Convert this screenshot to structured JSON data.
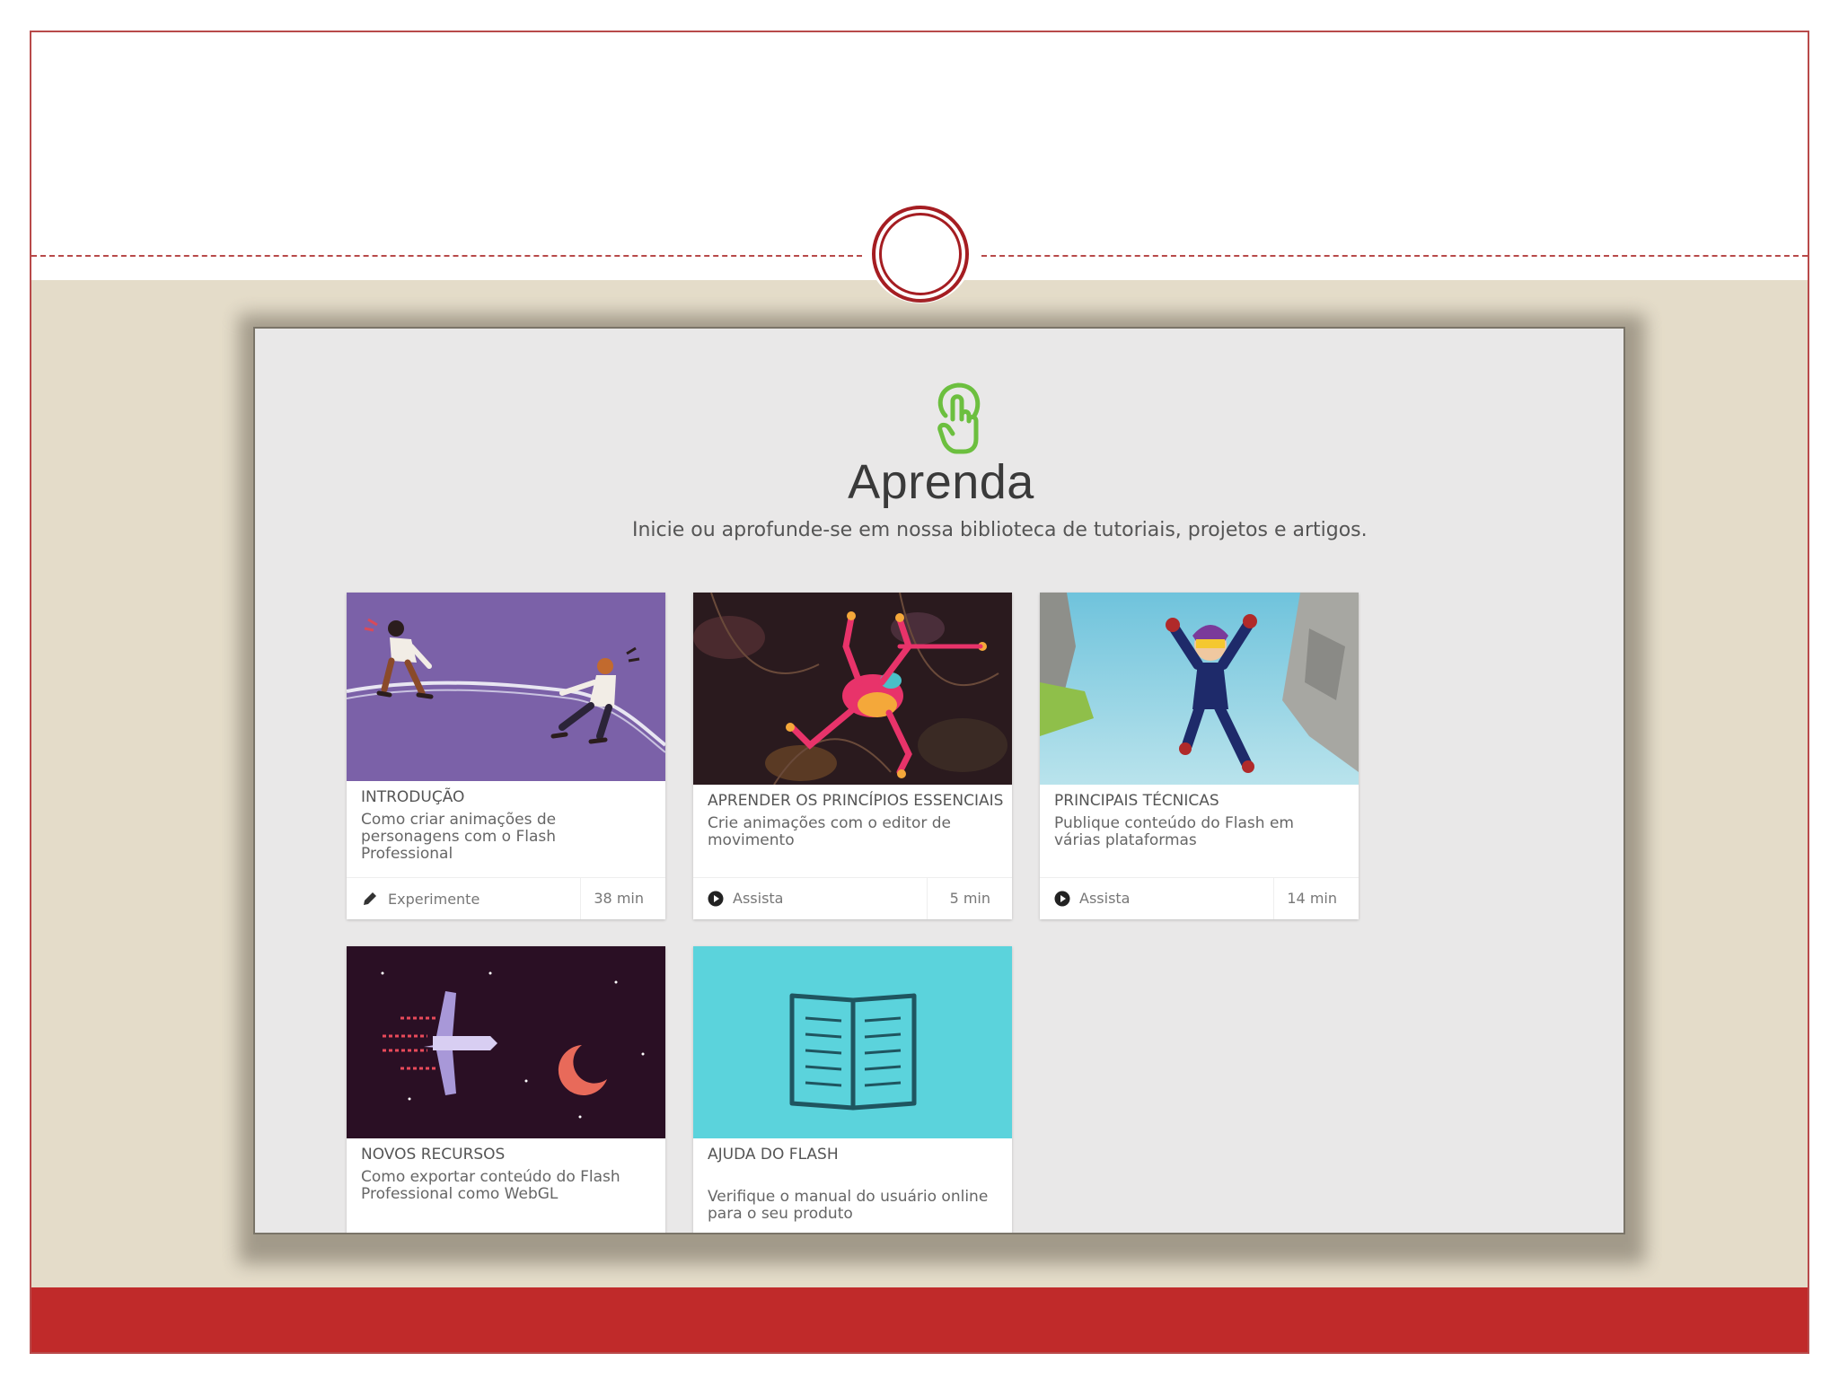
{
  "colors": {
    "frame_red": "#b84a4a",
    "beige": "#e4dcc9",
    "bottom_bar": "#c02a2a",
    "accent_green": "#6cbf3f",
    "teal": "#5bd3dc"
  },
  "learn": {
    "icon": "hand-touch-icon",
    "title": "Aprenda",
    "subtitle": "Inicie ou aprofunde-se em nossa biblioteca de tutoriais, projetos e artigos."
  },
  "cards": [
    {
      "category": "INTRODUÇÃO",
      "description": "Como criar animações de personagens com o Flash Professional",
      "action_icon": "pencil-icon",
      "action": "Experimente",
      "duration": "38 min"
    },
    {
      "category": "APRENDER OS PRINCÍPIOS ESSENCIAIS",
      "description": "Crie animações com o editor de movimento",
      "action_icon": "play-icon",
      "action": "Assista",
      "duration": "5 min"
    },
    {
      "category": "PRINCIPAIS TÉCNICAS",
      "description": "Publique conteúdo do Flash em várias plataformas",
      "action_icon": "play-icon",
      "action": "Assista",
      "duration": "14 min"
    },
    {
      "category": "NOVOS RECURSOS",
      "description": "Como exportar conteúdo do Flash Professional como WebGL"
    },
    {
      "category": "AJUDA DO FLASH",
      "description": "Verifique o manual do usuário online para o seu produto"
    }
  ]
}
